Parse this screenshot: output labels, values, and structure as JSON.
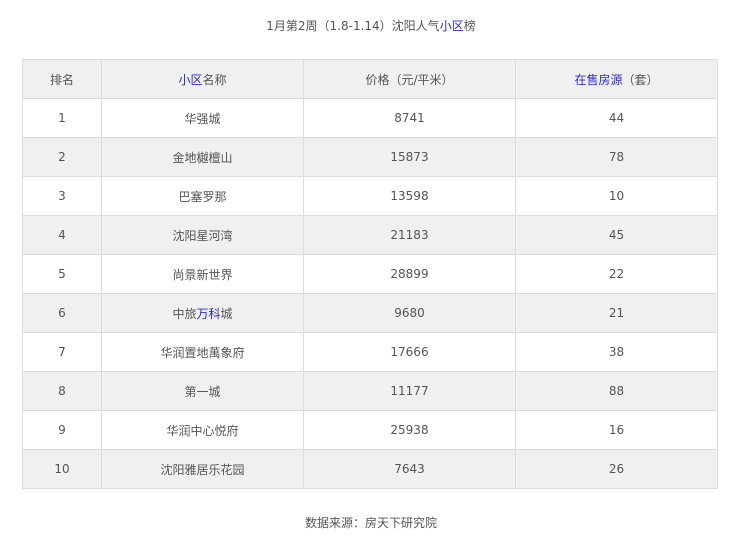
{
  "caption": {
    "prefix": "1月第2周（1.8-1.14）沈阳人气",
    "link": "小区",
    "suffix": "榜"
  },
  "table": {
    "headers": {
      "rank": "排名",
      "name_link": "小区",
      "name_rest": "名称",
      "price": "价格（元/平米）",
      "listings_link": "在售房源",
      "listings_rest": "（套）"
    },
    "rows": [
      {
        "rank": "1",
        "name": "华强城",
        "price": "8741",
        "listings": "44"
      },
      {
        "rank": "2",
        "name": "金地樾檀山",
        "price": "15873",
        "listings": "78"
      },
      {
        "rank": "3",
        "name": "巴塞罗那",
        "price": "13598",
        "listings": "10"
      },
      {
        "rank": "4",
        "name": "沈阳星河湾",
        "price": "21183",
        "listings": "45"
      },
      {
        "rank": "5",
        "name": "尚景新世界",
        "price": "28899",
        "listings": "22"
      },
      {
        "rank": "6",
        "name_prefix": "中旅",
        "name_link": "万科",
        "name_suffix": "城",
        "price": "9680",
        "listings": "21"
      },
      {
        "rank": "7",
        "name": "华润置地萬象府",
        "price": "17666",
        "listings": "38"
      },
      {
        "rank": "8",
        "name": "第一城",
        "price": "11177",
        "listings": "88"
      },
      {
        "rank": "9",
        "name": "华润中心悦府",
        "price": "25938",
        "listings": "16"
      },
      {
        "rank": "10",
        "name": "沈阳雅居乐花园",
        "price": "7643",
        "listings": "26"
      }
    ]
  },
  "source": "数据来源：房天下研究院",
  "colors": {
    "link": "#2b2bc8",
    "text": "#555555",
    "stripe": "#f0f0f0",
    "border": "#dcdcdc"
  }
}
